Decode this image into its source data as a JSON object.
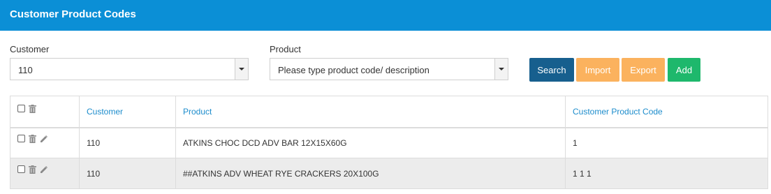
{
  "header": {
    "title": "Customer Product Codes"
  },
  "filters": {
    "customer": {
      "label": "Customer",
      "value": "110"
    },
    "product": {
      "label": "Product",
      "placeholder": "Please type product code/ description"
    }
  },
  "buttons": {
    "search": "Search",
    "import": "Import",
    "export": "Export",
    "add": "Add"
  },
  "table": {
    "columns": [
      "Customer",
      "Product",
      "Customer Product Code"
    ],
    "rows": [
      {
        "customer": "110",
        "product": "ATKINS CHOC DCD ADV BAR 12X15X60G",
        "code": "1"
      },
      {
        "customer": "110",
        "product": "##ATKINS ADV WHEAT RYE CRACKERS 20X100G",
        "code": "1 1 1"
      }
    ]
  },
  "icons": {
    "trash": "trash-icon",
    "edit": "pencil-icon",
    "dropdown": "chevron-down-icon"
  },
  "colors": {
    "header": "#0b8fd6",
    "search": "#175f8e",
    "import": "#fbb25e",
    "export": "#fbb25e",
    "add": "#1eb86c",
    "column_header_text": "#1c8ccc"
  }
}
